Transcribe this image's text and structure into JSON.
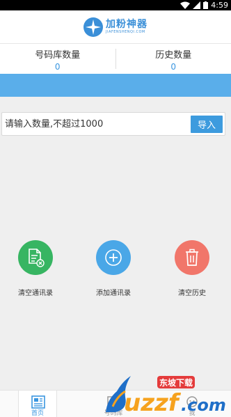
{
  "status_bar": {
    "time": "4:59"
  },
  "header": {
    "logo_text": "加粉神器",
    "logo_sub": "JIAFENSHENQI.COM"
  },
  "stats": [
    {
      "label": "号码库数量",
      "value": "0"
    },
    {
      "label": "历史数量",
      "value": "0"
    }
  ],
  "import": {
    "placeholder": "请输入数量,不超过1000",
    "button_label": "导入"
  },
  "actions": [
    {
      "label": "清空通讯录",
      "color": "#37b562",
      "icon": "clear-contacts-icon"
    },
    {
      "label": "添加通讯录",
      "color": "#4aa7e7",
      "icon": "add-icon"
    },
    {
      "label": "清空历史",
      "color": "#f1766a",
      "icon": "trash-icon"
    }
  ],
  "bottom_nav": [
    {
      "label": "首页",
      "icon": "home-icon",
      "active": true
    },
    {
      "label": "号码库",
      "icon": "number-library-icon",
      "active": false
    },
    {
      "label": "我",
      "icon": "profile-icon",
      "active": false
    }
  ],
  "watermark": {
    "text_main": "uzzf.com",
    "text_cn": "东坡下载"
  },
  "colors": {
    "accent": "#3a96e0",
    "band": "#5aaeea",
    "button": "#3d9bde"
  }
}
